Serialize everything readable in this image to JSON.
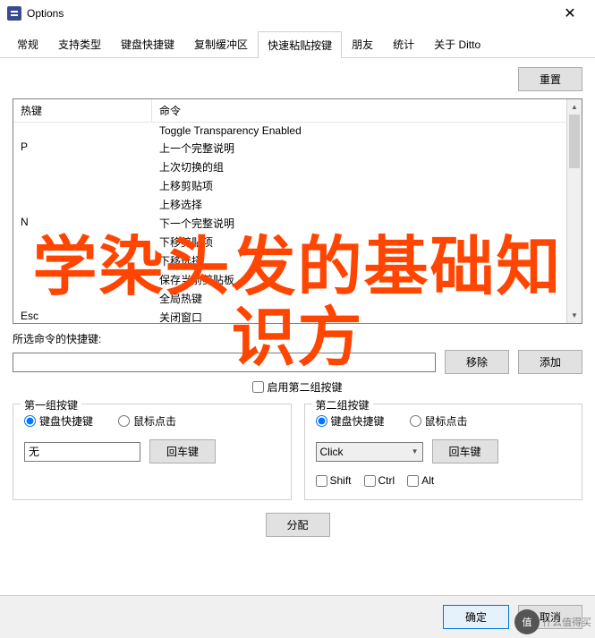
{
  "window": {
    "title": "Options"
  },
  "tabs": [
    "常规",
    "支持类型",
    "键盘快捷键",
    "复制缓冲区",
    "快速粘贴按键",
    "朋友",
    "统计",
    "关于 Ditto"
  ],
  "active_tab": 4,
  "reset_btn": "重置",
  "table": {
    "headers": [
      "热键",
      "命令"
    ],
    "rows": [
      {
        "key": "",
        "cmd": "Toggle Transparency Enabled"
      },
      {
        "key": "P",
        "cmd": "上一个完整说明"
      },
      {
        "key": "",
        "cmd": "上次切换的组"
      },
      {
        "key": "",
        "cmd": "上移剪贴项"
      },
      {
        "key": "",
        "cmd": "上移选择"
      },
      {
        "key": "N",
        "cmd": "下一个完整说明"
      },
      {
        "key": "",
        "cmd": "下移剪贴项"
      },
      {
        "key": "",
        "cmd": "下移选择"
      },
      {
        "key": "",
        "cmd": "保存当前剪贴板"
      },
      {
        "key": "",
        "cmd": "全局热键"
      },
      {
        "key": "Esc",
        "cmd": "关闭窗口"
      }
    ]
  },
  "selected_label": "所选命令的快捷键:",
  "selected_input": "",
  "remove_btn": "移除",
  "add_btn": "添加",
  "enable_group2_check": "启用第二组按键",
  "group1": {
    "legend": "第一组按键",
    "radio_kbd": "键盘快捷键",
    "radio_mouse": "鼠标点击",
    "input_value": "无",
    "enter_btn": "回车键"
  },
  "group2": {
    "legend": "第二组按键",
    "radio_kbd": "键盘快捷键",
    "radio_mouse": "鼠标点击",
    "combo_value": "Click",
    "enter_btn": "回车键",
    "mod_shift": "Shift",
    "mod_ctrl": "Ctrl",
    "mod_alt": "Alt"
  },
  "assign_btn": "分配",
  "ok_btn": "确定",
  "cancel_btn": "取消",
  "overlay_text": "学染头发的基础知识方",
  "watermark": {
    "char": "值",
    "text": "什么值得买"
  }
}
